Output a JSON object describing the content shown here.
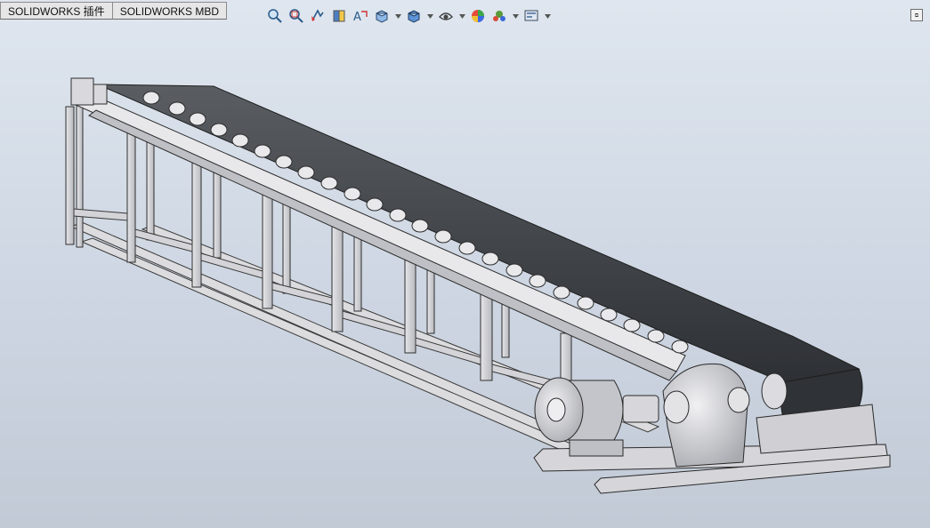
{
  "tabs": [
    {
      "label": "SOLIDWORKS 插件"
    },
    {
      "label": "SOLIDWORKS MBD"
    }
  ],
  "headsup_toolbar": [
    {
      "icon": "zoom-to-fit-icon",
      "dropdown": false
    },
    {
      "icon": "zoom-to-area-icon",
      "dropdown": false
    },
    {
      "icon": "previous-view-icon",
      "dropdown": false
    },
    {
      "icon": "section-view-icon",
      "dropdown": false
    },
    {
      "icon": "dynamic-annotation-icon",
      "dropdown": false
    },
    {
      "icon": "view-orientation-icon",
      "dropdown": true
    },
    {
      "icon": "display-style-icon",
      "dropdown": true
    },
    {
      "icon": "hide-show-items-icon",
      "dropdown": true
    },
    {
      "icon": "edit-appearance-icon",
      "dropdown": false
    },
    {
      "icon": "apply-scene-icon",
      "dropdown": true
    },
    {
      "icon": "view-settings-icon",
      "dropdown": true
    }
  ],
  "window_control": {
    "icon": "restore-window-icon"
  },
  "model": {
    "description_icon": "belt-conveyor-model"
  }
}
